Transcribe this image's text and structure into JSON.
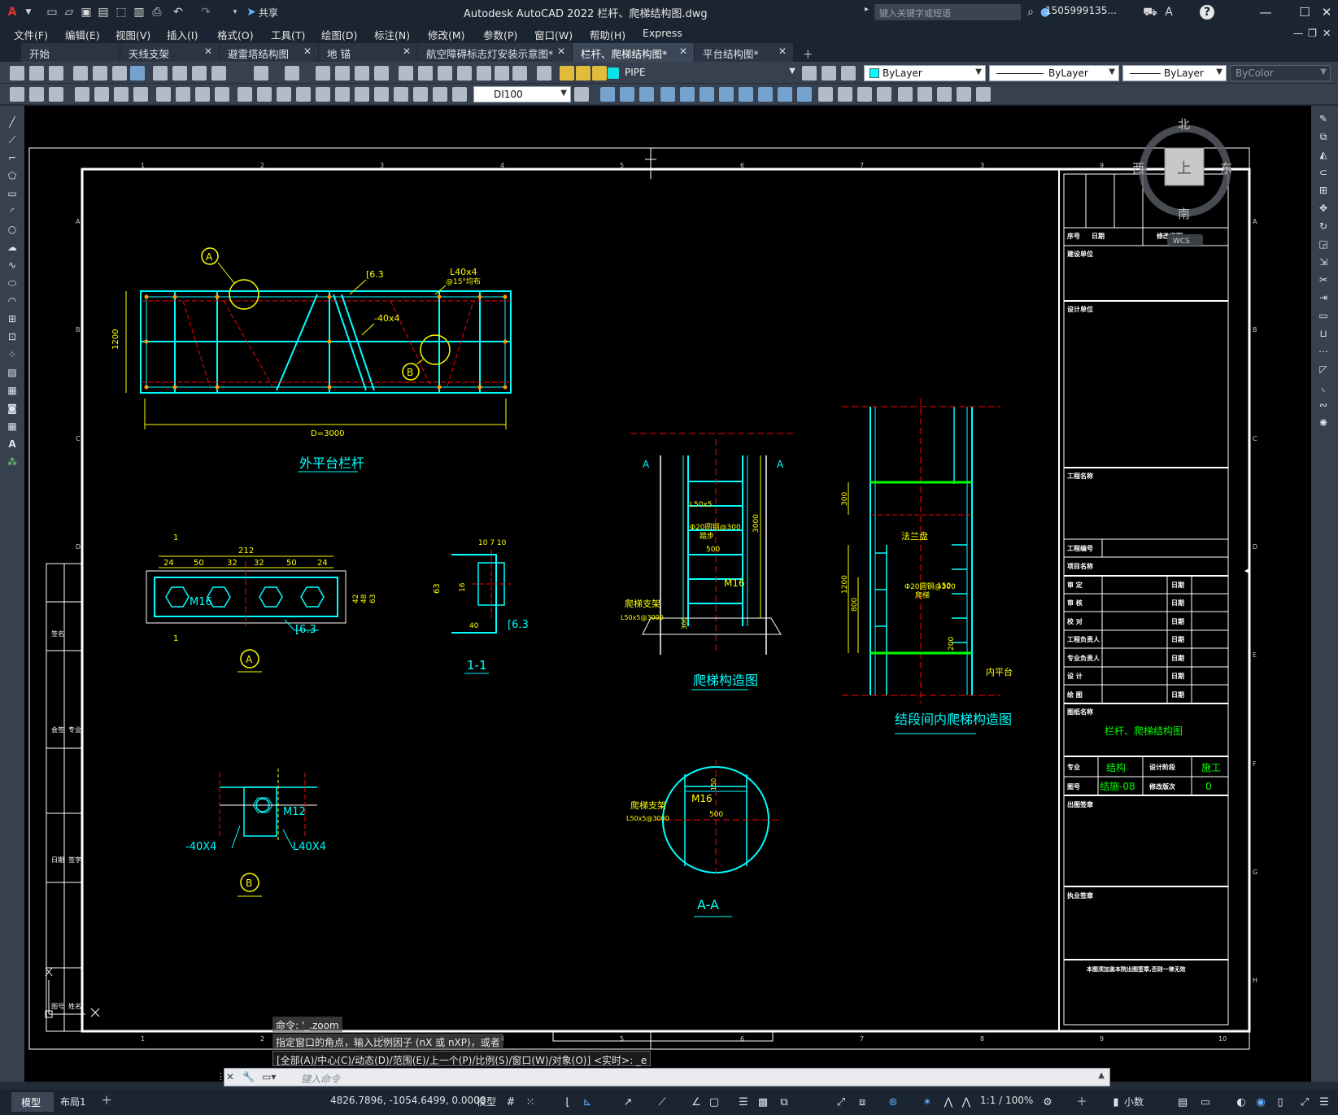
{
  "app": {
    "title": "Autodesk AutoCAD 2022    栏杆、爬梯结构图.dwg",
    "logo": "A",
    "share_label": "共享",
    "search_placeholder": "键入关键字或短语",
    "user": "1505999135...",
    "help": "?"
  },
  "menu": [
    "文件(F)",
    "编辑(E)",
    "视图(V)",
    "插入(I)",
    "格式(O)",
    "工具(T)",
    "绘图(D)",
    "标注(N)",
    "修改(M)",
    "参数(P)",
    "窗口(W)",
    "帮助(H)",
    "Express"
  ],
  "tabs": [
    {
      "label": "开始",
      "active": false
    },
    {
      "label": "天线支架",
      "active": false
    },
    {
      "label": "避雷塔结构图",
      "active": false
    },
    {
      "label": "地 锚",
      "active": false
    },
    {
      "label": "航空障碍标志灯安装示意图*",
      "active": false
    },
    {
      "label": "栏杆、爬梯结构图*",
      "active": true
    },
    {
      "label": "平台结构图*",
      "active": false
    }
  ],
  "layer": {
    "name": "PIPE",
    "color_prop": "ByLayer",
    "linetype": "ByLayer",
    "lineweight": "ByLayer",
    "plotstyle": "ByColor",
    "dimstyle": "DI100"
  },
  "viewcube": {
    "n": "北",
    "s": "南",
    "e": "东",
    "w": "西",
    "top": "上",
    "wcs": "WCS"
  },
  "drawing": {
    "ruler_top": [
      "1",
      "2",
      "3",
      "4",
      "5",
      "6",
      "7",
      "3",
      "9"
    ],
    "ruler_bottom": [
      "1",
      "2",
      "3",
      "4",
      "5",
      "6",
      "7",
      "8",
      "9",
      "10"
    ],
    "ruler_side": [
      "A",
      "B",
      "C",
      "D",
      "E",
      "F",
      "G",
      "H"
    ],
    "views": {
      "railing_title": "外平台栏杆",
      "railing_dims": {
        "height": "1200",
        "length": "D=3000",
        "c": "[6.3",
        "angle": "L40x4",
        "angle_note": "@15°均布",
        "flat": "-40x4"
      },
      "detail_a_title": "A",
      "detail_a_dims": {
        "total": "212",
        "segs": [
          "24",
          "50",
          "32",
          "32",
          "50",
          "24"
        ],
        "bolt": "M16",
        "channel": "[6.3",
        "right": [
          "42",
          "48",
          "63"
        ],
        "sec": "1"
      },
      "section_title": "1-1",
      "section_dims": {
        "top": "10 7 10",
        "h": "63",
        "mid": "16",
        "w": "40",
        "c": "[6.3"
      },
      "ladder_title": "爬梯构造图",
      "ladder_dims": {
        "angle": "L50x5",
        "rung": "Φ20圆钢@300",
        "rung2": "踏步",
        "width": "500",
        "bolt": "M16",
        "support": "爬梯支架",
        "support2": "L50x5@3000",
        "height": "3000",
        "base": "300",
        "sec": "A"
      },
      "inner_title": "结段间内爬梯构造图",
      "inner_dims": {
        "flange": "法兰盘",
        "rung": "Φ20圆钢@300",
        "rung2": "爬梯",
        "d1": "300",
        "d2": "1200",
        "d3": "800",
        "d4": "150",
        "d5": "200",
        "platform": "内平台"
      },
      "detail_b_title": "B",
      "detail_b_dims": {
        "bolt": "M12",
        "flat": "-40X4",
        "angle": "L40X4"
      },
      "aa_title": "A-A",
      "aa_dims": {
        "bolt": "M16",
        "width": "500",
        "h": "150",
        "support": "爬梯支架",
        "support2": "L50x5@3000"
      }
    },
    "title_block": {
      "rev_headers": [
        "序号",
        "日期",
        "修改说明"
      ],
      "construction_unit": "建设单位",
      "design_unit": "设计单位",
      "project_name": "工程名称",
      "project_no": "工程编号",
      "item_name": "项目名称",
      "roles": [
        {
          "role": "审    定",
          "date": "日期"
        },
        {
          "role": "审    核",
          "date": "日期"
        },
        {
          "role": "校    对",
          "date": "日期"
        },
        {
          "role": "工程负责人",
          "date": "日期"
        },
        {
          "role": "专业负责人",
          "date": "日期"
        },
        {
          "role": "设    计",
          "date": "日期"
        },
        {
          "role": "绘    图",
          "date": "日期"
        }
      ],
      "drawing_name_label": "图纸名称",
      "drawing_name": "栏杆、爬梯结构图",
      "discipline_label": "专业",
      "discipline": "结构",
      "stage_label": "设计阶段",
      "stage": "施工",
      "drawing_no_label": "图号",
      "drawing_no": "结施-08",
      "revision_label": "修改版次",
      "revision": "0",
      "issue_stamp": "出图签章",
      "license_stamp": "执业签章",
      "footnote": "本图须加盖本院出图签章,否则一律无效"
    },
    "left_strip": [
      "签名",
      "专业",
      "会签",
      "签字",
      "日期",
      "姓名",
      "图号"
    ]
  },
  "command": {
    "history": [
      "命令: '_.zoom",
      "指定窗口的角点，输入比例因子 (nX 或 nXP)，或者",
      "[全部(A)/中心(C)/动态(D)/范围(E)/上一个(P)/比例(S)/窗口(W)/对象(O)] <实时>: _e"
    ],
    "placeholder": "键入命令"
  },
  "status": {
    "layout_tabs": [
      "模型",
      "布局1"
    ],
    "coords": "4826.7896, -1054.6499, 0.0000",
    "space": "模型",
    "scale": "1:1 / 100%",
    "units": "小数"
  },
  "colors": {
    "cyan": "#00ffff",
    "yellow": "#ffff00",
    "red": "#ff0000",
    "green": "#00ff00",
    "white": "#ffffff"
  }
}
